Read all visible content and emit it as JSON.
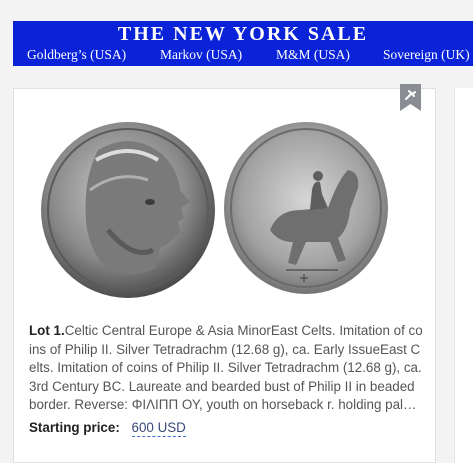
{
  "banner": {
    "title": "THE NEW YORK SALE",
    "houses": [
      "Goldberg’s (USA)",
      "Markov (USA)",
      "M&M (USA)",
      "Sovereign (UK)"
    ]
  },
  "lot": {
    "label": "Lot 1.",
    "description": "Celtic Central Europe & Asia MinorEast Celts. Imitation of coins of Philip II. Silver Tetradrachm (12.68 g), ca. Early IssueEast Celts. Imitation of coins of Philip II. Silver Tetradrachm (12.68 g), ca. 3rd Century BC. Laureate and bearded bust of Philip II in beaded border. Reverse: ΦΙΛΙΠΠ ΟΥ, youth on horseback r. holding palm branch.",
    "price_label": "Starting price:",
    "price_value": "600 USD"
  },
  "icons": {
    "bookmark": "bookmark-icon"
  },
  "colors": {
    "banner_bg": "#0a23d9",
    "banner_text": "#ffffff",
    "price_link": "#3a4a7a"
  }
}
